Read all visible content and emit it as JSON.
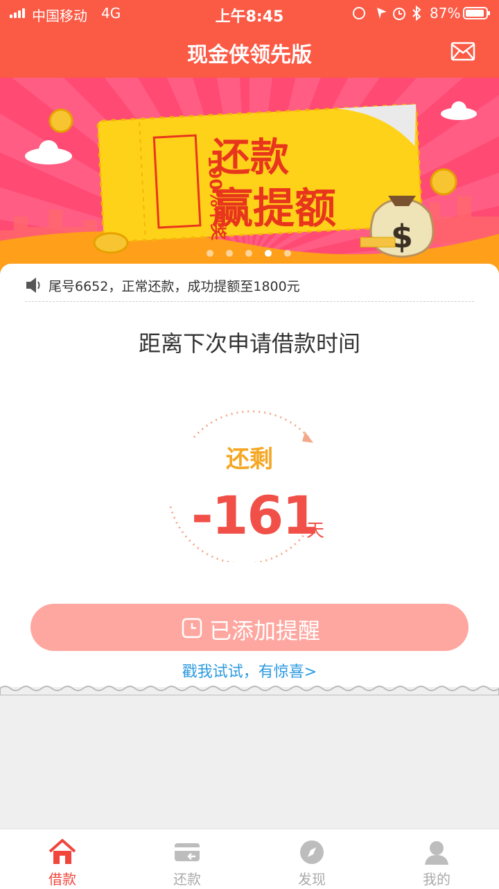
{
  "status_bar": {
    "carrier": "中国移动",
    "network": "4G",
    "time": "上午8:45",
    "battery_percent": "87%"
  },
  "header": {
    "title": "现金侠领先版",
    "mail_icon": "envelope-icon"
  },
  "banner": {
    "badge_text": "100%中奖",
    "headline_line1": "还款",
    "headline_line2": "赢提额",
    "active_slide": 4,
    "slide_count": 5,
    "colors": {
      "bg": "#ff4a73",
      "ticket": "#ffd21a",
      "headline": "#e8361c"
    }
  },
  "notice": {
    "icon": "speaker-icon",
    "text": "尾号6652，正常还款，成功提额至1800元"
  },
  "countdown": {
    "title": "距离下次申请借款时间",
    "remain_label": "还剩",
    "days_value": "-161",
    "days_unit": "天"
  },
  "reminder_button": {
    "label": "已添加提醒",
    "icon": "clock-icon"
  },
  "surprise_link": "戳我试试，有惊喜>",
  "tabbar": {
    "items": [
      {
        "label": "借款",
        "icon": "home-icon",
        "active": true
      },
      {
        "label": "还款",
        "icon": "card-icon",
        "active": false
      },
      {
        "label": "发现",
        "icon": "compass-icon",
        "active": false
      },
      {
        "label": "我的",
        "icon": "user-icon",
        "active": false
      }
    ]
  },
  "colors": {
    "brand": "#fb5a45",
    "accent_red": "#f05048",
    "accent_orange": "#f5a623",
    "link": "#2b9ae0",
    "button_bg": "#fea7a0"
  }
}
